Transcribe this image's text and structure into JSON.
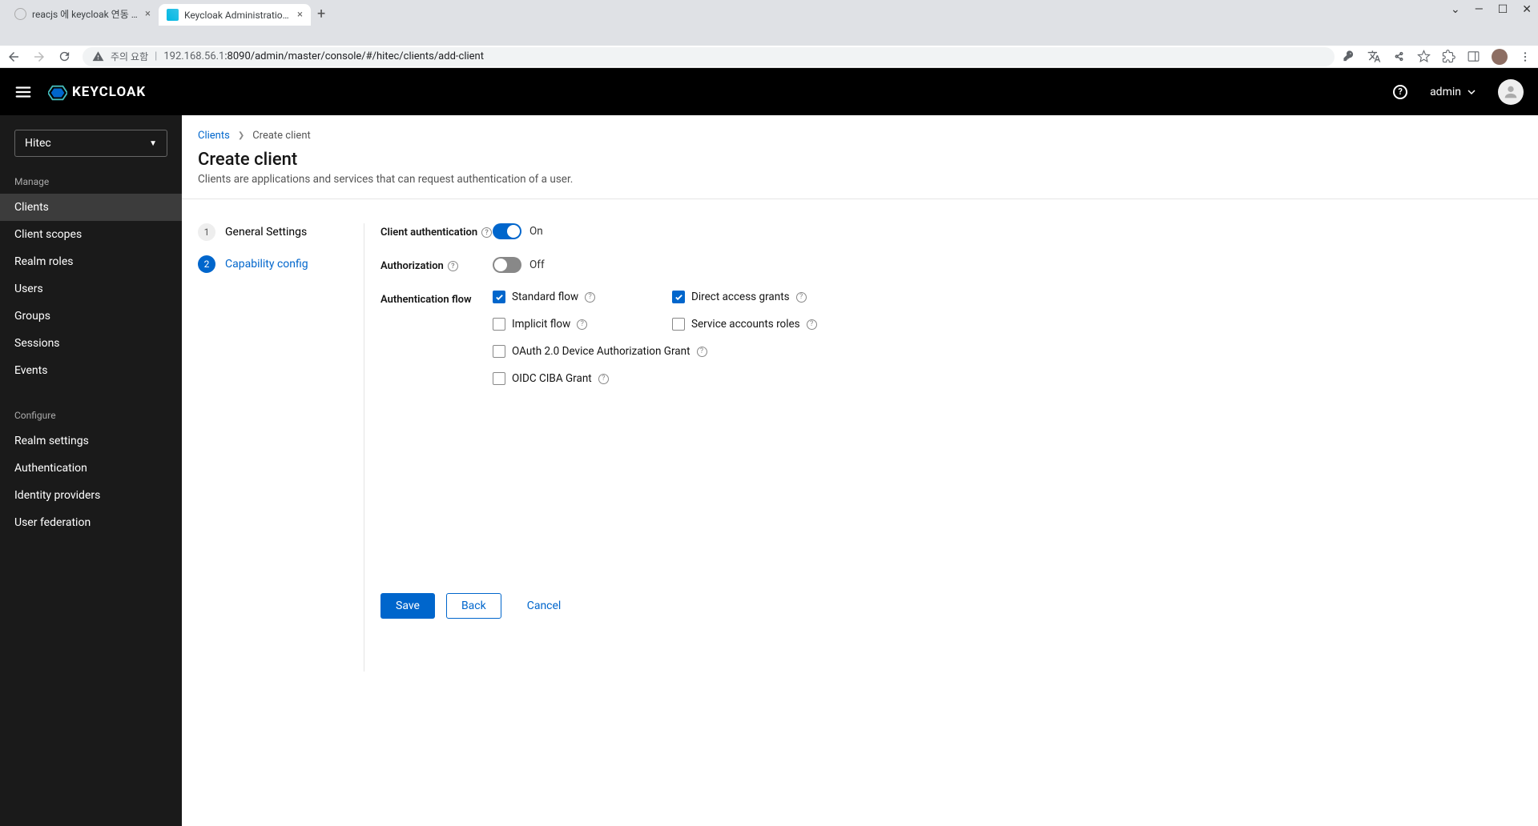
{
  "browser": {
    "tabs": [
      {
        "title": "reacjs 에 keycloak 연동 | hitec D"
      },
      {
        "title": "Keycloak Administration Consol"
      }
    ],
    "urlWarn": "주의 요함",
    "urlHost": "192.168.56.1",
    "urlPath": ":8090/admin/master/console/#/hitec/clients/add-client"
  },
  "header": {
    "logo": "KEYCLOAK",
    "user": "admin"
  },
  "sidebar": {
    "realm": "Hitec",
    "sectionManage": "Manage",
    "items": [
      "Clients",
      "Client scopes",
      "Realm roles",
      "Users",
      "Groups",
      "Sessions",
      "Events"
    ],
    "sectionConfigure": "Configure",
    "configItems": [
      "Realm settings",
      "Authentication",
      "Identity providers",
      "User federation"
    ]
  },
  "breadcrumb": {
    "root": "Clients",
    "current": "Create client"
  },
  "page": {
    "title": "Create client",
    "subtitle": "Clients are applications and services that can request authentication of a user."
  },
  "wizard": {
    "step1": "General Settings",
    "step2": "Capability config"
  },
  "form": {
    "clientAuthLabel": "Client authentication",
    "authLabel": "Authorization",
    "flowLabel": "Authentication flow",
    "on": "On",
    "off": "Off",
    "checks": {
      "standard": "Standard flow",
      "direct": "Direct access grants",
      "implicit": "Implicit flow",
      "service": "Service accounts roles",
      "oauth": "OAuth 2.0 Device Authorization Grant",
      "ciba": "OIDC CIBA Grant"
    },
    "buttons": {
      "save": "Save",
      "back": "Back",
      "cancel": "Cancel"
    }
  }
}
